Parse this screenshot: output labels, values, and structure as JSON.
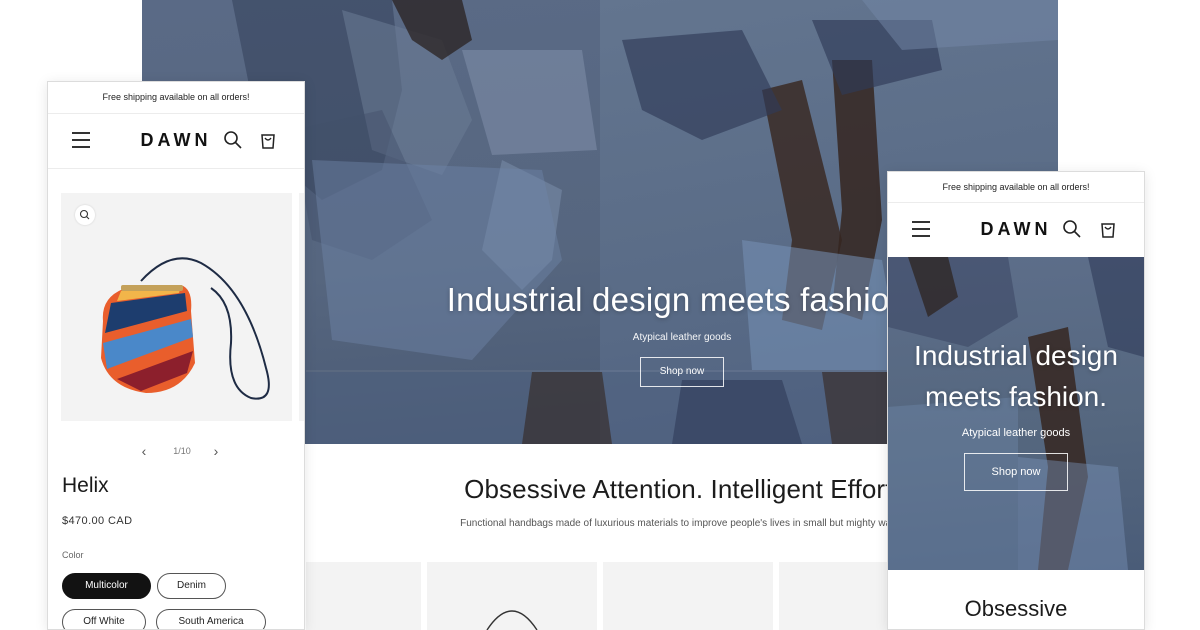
{
  "desktop": {
    "hero": {
      "title": "Industrial design meets fashion.",
      "subtitle": "Atypical leather goods",
      "button_label": "Shop now"
    },
    "section": {
      "heading": "Obsessive Attention. Intelligent Effort.",
      "caption": "Functional handbags made of luxurious materials to improve people's lives in small but mighty ways."
    }
  },
  "mobile_product": {
    "announcement": "Free shipping available on all orders!",
    "header": {
      "logo": "DAWN",
      "icons": [
        "menu-icon",
        "search-icon",
        "cart-icon"
      ]
    },
    "gallery": {
      "counter": "1/10",
      "prev_arrow": "‹",
      "next_arrow": "›"
    },
    "product": {
      "title": "Helix",
      "price": "$470.00 CAD",
      "color_label": "Color",
      "color_options": [
        "Multicolor",
        "Denim",
        "Off White",
        "South America"
      ],
      "selected_color": "Multicolor"
    }
  },
  "mobile_hero": {
    "announcement": "Free shipping available on all orders!",
    "header": {
      "logo": "DAWN",
      "icons": [
        "menu-icon",
        "search-icon",
        "cart-icon"
      ]
    },
    "hero": {
      "title_line1": "Industrial design",
      "title_line2": "meets fashion.",
      "subtitle": "Atypical leather goods",
      "button_label": "Shop now"
    },
    "heading": "Obsessive"
  },
  "colors": {
    "hero_blue": "#56687f",
    "text": "#121212",
    "swatch_selected": "#121212",
    "panel_border": "#dcdcdc"
  }
}
